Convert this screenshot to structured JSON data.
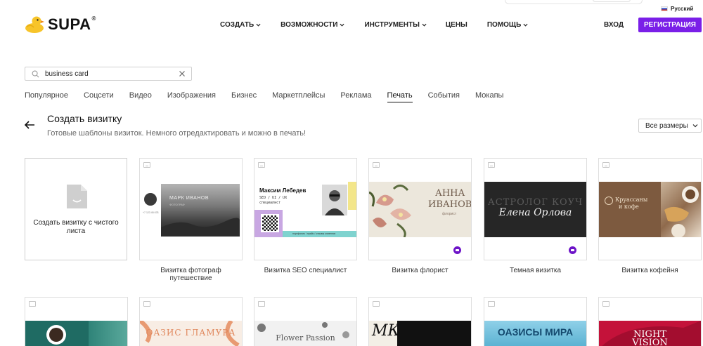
{
  "header": {
    "logo_text": "SUPA",
    "logo_reg": "®",
    "language": "Русский",
    "nav": [
      {
        "label": "СОЗДАТЬ",
        "dropdown": true
      },
      {
        "label": "ВОЗМОЖНОСТИ",
        "dropdown": true
      },
      {
        "label": "ИНСТРУМЕНТЫ",
        "dropdown": true
      },
      {
        "label": "ЦЕНЫ",
        "dropdown": false
      },
      {
        "label": "ПОМОЩЬ",
        "dropdown": true
      }
    ],
    "login_label": "ВХОД",
    "register_label": "РЕГИСТРАЦИЯ"
  },
  "search": {
    "value": "business card",
    "placeholder": ""
  },
  "categories": [
    {
      "label": "Популярное",
      "active": false
    },
    {
      "label": "Соцсети",
      "active": false
    },
    {
      "label": "Видео",
      "active": false
    },
    {
      "label": "Изображения",
      "active": false
    },
    {
      "label": "Бизнес",
      "active": false
    },
    {
      "label": "Маркетплейсы",
      "active": false
    },
    {
      "label": "Реклама",
      "active": false
    },
    {
      "label": "Печать",
      "active": true
    },
    {
      "label": "События",
      "active": false
    },
    {
      "label": "Мокапы",
      "active": false
    }
  ],
  "section": {
    "title": "Создать визитку",
    "subtitle": "Готовые шаблоны визиток. Немного отредактировать и можно в печать!",
    "sizes_label": "Все размеры"
  },
  "blank_card": {
    "label": "Создать визитку с чистого листа"
  },
  "templates": [
    {
      "label": "Визитка фотограф путешествие",
      "premium": false,
      "thumb_text": {
        "name": "МАРК ИВАНОВ",
        "role": "ФОТОГРАФ",
        "contacts": "+7 123 45 678"
      }
    },
    {
      "label": "Визитка SEO специалист",
      "premium": false,
      "thumb_text": {
        "name": "Максим Лебедев",
        "role": "SEO / UI / UX",
        "role2": "специалист",
        "footer": "портфолио / прайс / отзывы клиентов"
      }
    },
    {
      "label": "Визитка флорист",
      "premium": true,
      "thumb_text": {
        "name1": "АННА",
        "name2": "ИВАНОВА",
        "role": "флорист"
      }
    },
    {
      "label": "Темная визитка",
      "premium": true,
      "thumb_text": {
        "title": "АСТРОЛОГ КОУЧ",
        "name": "Елена Орлова"
      }
    },
    {
      "label": "Визитка кофейня",
      "premium": false,
      "thumb_text": {
        "title": "Круассаны",
        "title2": "и кофе"
      }
    }
  ],
  "row2": [
    {
      "text": ""
    },
    {
      "text": "ОАЗИС ГЛАМУРА"
    },
    {
      "text": "Flower Passion"
    },
    {
      "text": "МК"
    },
    {
      "text": "ОАЗИСЫ МИРА"
    },
    {
      "text": "NIGHT VISION"
    }
  ],
  "colors": {
    "accent": "#7a1fe8",
    "premium_badge": "#6d14c8"
  }
}
